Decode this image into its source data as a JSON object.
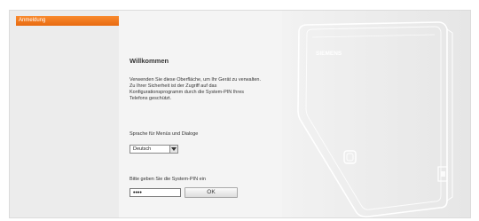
{
  "nav": {
    "login_label": "Anmeldung"
  },
  "welcome": {
    "title": "Willkommen",
    "intro": "Verwenden Sie diese Oberfläche, um Ihr Gerät zu verwalten. Zu Ihrer Sicherheit ist der Zugriff auf das Konfigurationsprogramm durch die System-PIN Ihres Telefons geschützt."
  },
  "language": {
    "label": "Sprache für Menüs und Dialoge",
    "selected": "Deutsch"
  },
  "pin": {
    "label": "Bitte geben Sie die System-PIN ein",
    "value": "••••"
  },
  "buttons": {
    "ok_label": "OK"
  },
  "device": {
    "brand": "SIEMENS"
  },
  "colors": {
    "accent": "#f07a1c"
  }
}
